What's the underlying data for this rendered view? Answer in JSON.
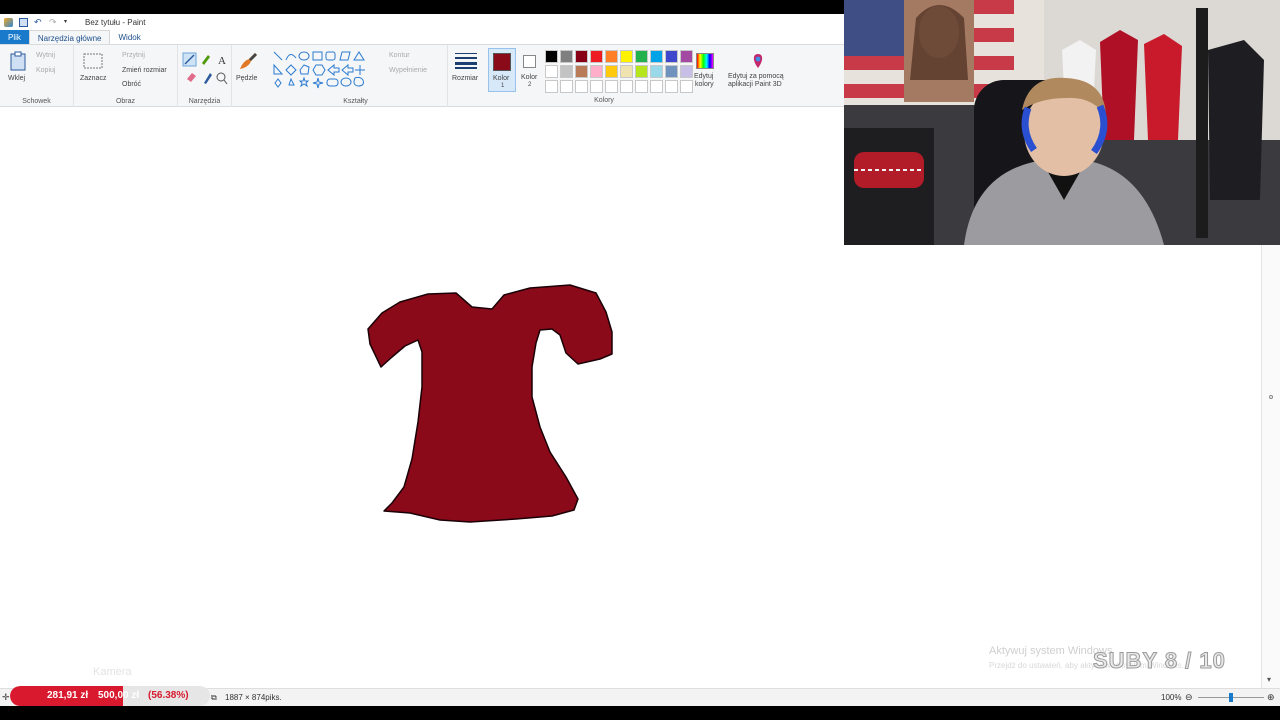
{
  "window": {
    "title": "Bez tytułu - Paint"
  },
  "tabs": [
    {
      "label": "Plik"
    },
    {
      "label": "Narzędzia główne"
    },
    {
      "label": "Widok"
    }
  ],
  "ribbon": {
    "clipboard": {
      "paste": "Wklej",
      "cut": "Wytnij",
      "copy": "Kopiuj",
      "group": "Schowek"
    },
    "image": {
      "select": "Zaznacz",
      "crop": "Przytnij",
      "resize": "Zmień rozmiar",
      "rotate": "Obróć",
      "group": "Obraz"
    },
    "tools": {
      "group": "Narzędzia"
    },
    "brushes": {
      "label": "Pędzle"
    },
    "shapes": {
      "outline": "Kontur",
      "fill": "Wypełnienie",
      "group": "Kształty"
    },
    "size": {
      "label": "Rozmiar"
    },
    "color1": {
      "label": "Kolor",
      "sub": "1",
      "value": "#8b0a1a"
    },
    "color2": {
      "label": "Kolor",
      "sub": "2",
      "value": "#ffffff"
    },
    "edit_colors": {
      "label": "Edytuj",
      "label2": "kolory"
    },
    "paint3d": {
      "label": "Edytuj za pomocą",
      "label2": "aplikacji Paint 3D"
    },
    "colors_group": "Kolory",
    "palette": [
      "#000000",
      "#7f7f7f",
      "#880015",
      "#ed1c24",
      "#ff7f27",
      "#fff200",
      "#22b14c",
      "#00a2e8",
      "#3f48cc",
      "#a349a4",
      "#ffffff",
      "#c3c3c3",
      "#b97a57",
      "#ffaec9",
      "#ffc90e",
      "#efe4b0",
      "#b5e61d",
      "#99d9ea",
      "#7092be",
      "#c8bfe7",
      "#ffffff",
      "#ffffff",
      "#ffffff",
      "#ffffff",
      "#ffffff",
      "#ffffff",
      "#ffffff",
      "#ffffff",
      "#ffffff",
      "#ffffff"
    ]
  },
  "drawing": {
    "shape": "dress",
    "fill": "#8b0a1a"
  },
  "status": {
    "canvas_size": "1887 × 874piks.",
    "zoom": "100%"
  },
  "donation": {
    "current": "281,91 zł",
    "goal": "500,00 zł",
    "percent": "(56.38%)",
    "fraction": 0.5638
  },
  "overlays": {
    "camera": "Kamera",
    "activate_line1": "Aktywuj system Windows",
    "activate_line2": "Przejdź do ustawień, aby aktywować system Windows.",
    "subs": "SUBY 8 / 10"
  }
}
